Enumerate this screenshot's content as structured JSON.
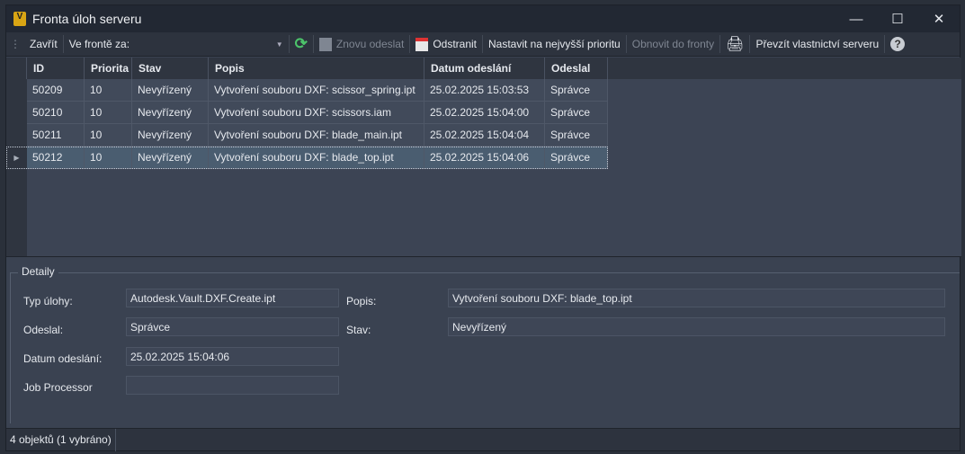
{
  "window": {
    "title": "Fronta úloh serveru",
    "icon": "vault-app-icon"
  },
  "toolbar": {
    "close": "Zavřít",
    "queued_for": "Ve frontě za:",
    "queued_for_value": "",
    "resubmit": "Znovu odeslat",
    "remove": "Odstranit",
    "top_priority": "Nastavit na nejvyšší prioritu",
    "requeue": "Obnovit do fronty",
    "take_ownership": "Převzít vlastnictví serveru",
    "help": "?"
  },
  "grid": {
    "columns": [
      "ID",
      "Priorita",
      "Stav",
      "Popis",
      "Datum odeslání",
      "Odeslal"
    ],
    "rows": [
      [
        "50209",
        "10",
        "Nevyřízený",
        "Vytvoření souboru DXF: scissor_spring.ipt",
        "25.02.2025 15:03:53",
        "Správce"
      ],
      [
        "50210",
        "10",
        "Nevyřízený",
        "Vytvoření souboru DXF: scissors.iam",
        "25.02.2025 15:04:00",
        "Správce"
      ],
      [
        "50211",
        "10",
        "Nevyřízený",
        "Vytvoření souboru DXF: blade_main.ipt",
        "25.02.2025 15:04:04",
        "Správce"
      ],
      [
        "50212",
        "10",
        "Nevyřízený",
        "Vytvoření souboru DXF: blade_top.ipt",
        "25.02.2025 15:04:06",
        "Správce"
      ]
    ],
    "selected_index": 3
  },
  "details": {
    "legend": "Detaily",
    "job_type_label": "Typ úlohy:",
    "job_type": "Autodesk.Vault.DXF.Create.ipt",
    "submitted_by_label": "Odeslal:",
    "submitted_by": "Správce",
    "date_label": "Datum odeslání:",
    "date": "25.02.2025 15:04:06",
    "processor_label": "Job Processor",
    "processor": "",
    "desc_label": "Popis:",
    "desc": "Vytvoření souboru DXF: blade_top.ipt",
    "status_label": "Stav:",
    "status": "Nevyřízený"
  },
  "statusbar": {
    "text": "4 objektů (1 vybráno)"
  }
}
